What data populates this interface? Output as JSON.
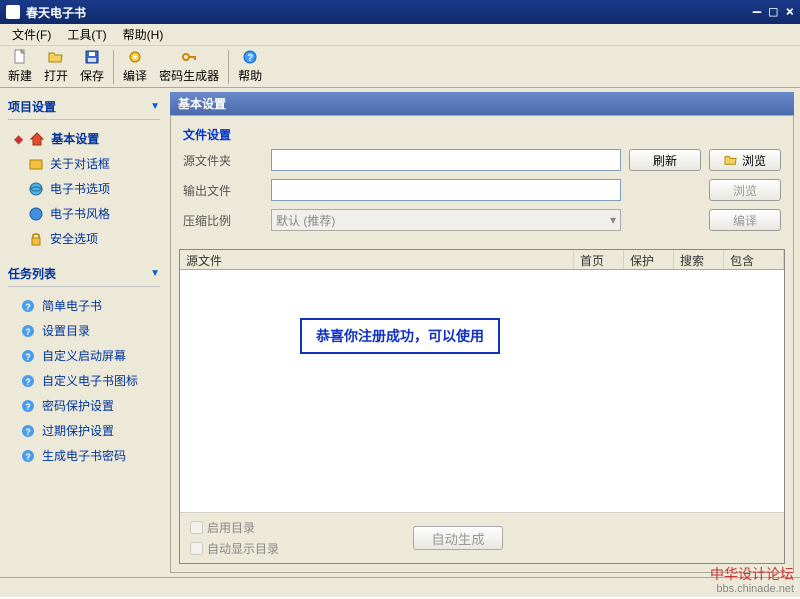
{
  "title": "春天电子书",
  "menus": {
    "file": "文件(F)",
    "tools": "工具(T)",
    "help": "帮助(H)"
  },
  "toolbar": {
    "new": "新建",
    "open": "打开",
    "save": "保存",
    "compile": "编译",
    "pwdgen": "密码生成器",
    "help": "帮助"
  },
  "sidebar": {
    "project_head": "项目设置",
    "items": [
      {
        "label": "基本设置"
      },
      {
        "label": "关于对话框"
      },
      {
        "label": "电子书选项"
      },
      {
        "label": "电子书风格"
      },
      {
        "label": "安全选项"
      }
    ],
    "tasks_head": "任务列表",
    "tasks": [
      {
        "label": "简单电子书"
      },
      {
        "label": "设置目录"
      },
      {
        "label": "自定义启动屏幕"
      },
      {
        "label": "自定义电子书图标"
      },
      {
        "label": "密码保护设置"
      },
      {
        "label": "过期保护设置"
      },
      {
        "label": "生成电子书密码"
      }
    ]
  },
  "panel": {
    "title": "基本设置",
    "file_section": "文件设置",
    "rows": {
      "src_label": "源文件夹",
      "refresh": "刷新",
      "browse": "浏览",
      "out_label": "输出文件",
      "browse2": "浏览",
      "ratio_label": "压缩比例",
      "ratio_value": "默认 (推荐)",
      "compile": "编译"
    },
    "src_cols": {
      "file": "源文件",
      "home": "首页",
      "protect": "保护",
      "search": "搜索",
      "include": "包含"
    },
    "success": "恭喜你注册成功，可以使用",
    "foot": {
      "enable_toc": "启用目录",
      "auto_show_toc": "自动显示目录",
      "auto_gen": "自动生成"
    }
  },
  "watermark": {
    "cn": "中华设计论坛",
    "url": "bbs.chinade.net"
  }
}
